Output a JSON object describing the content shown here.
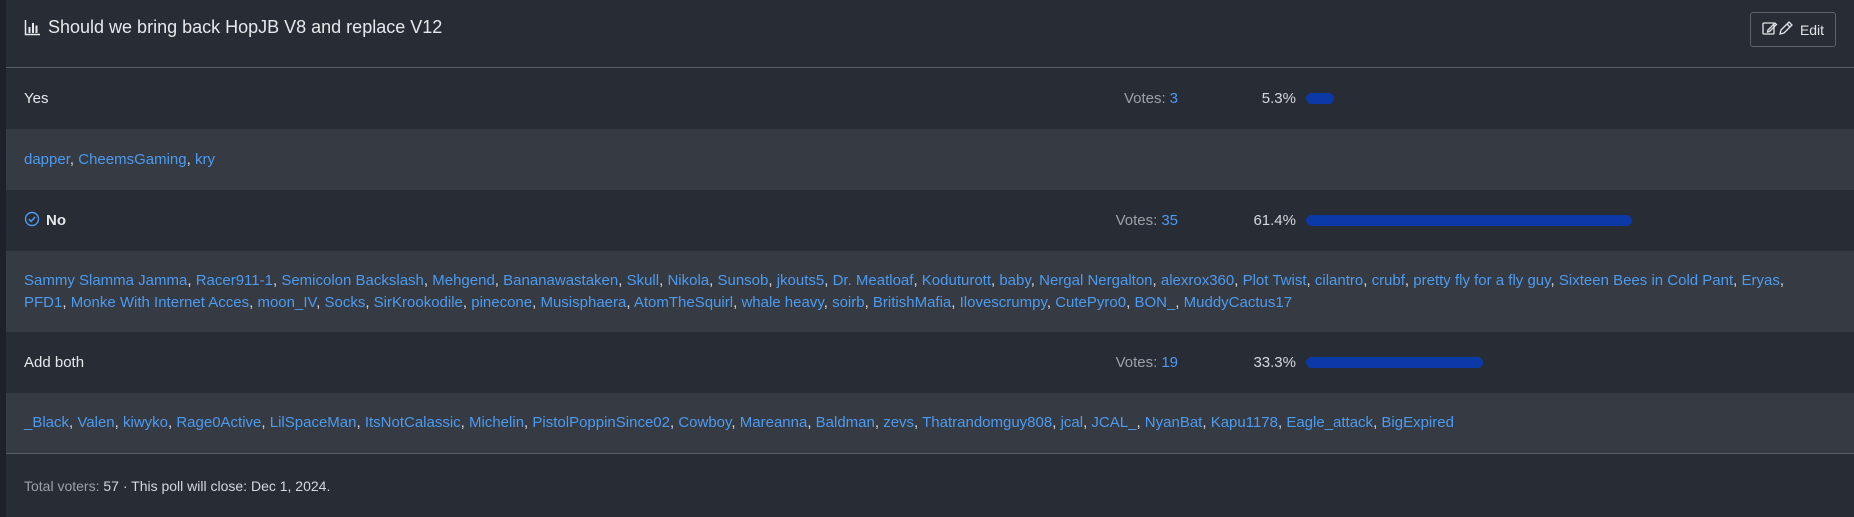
{
  "poll": {
    "title": "Should we bring back HopJB V8 and replace V12",
    "edit_label": "Edit",
    "options": [
      {
        "label": "Yes",
        "selected": false,
        "votes_label": "Votes:",
        "votes": "3",
        "percent": "5.3%",
        "fraction": 0.087,
        "voters": [
          "dapper",
          "CheemsGaming",
          "kry"
        ]
      },
      {
        "label": "No",
        "selected": true,
        "votes_label": "Votes:",
        "votes": "35",
        "percent": "61.4%",
        "fraction": 1.0,
        "voters": [
          "Sammy Slamma Jamma",
          "Racer911-1",
          "Semicolon Backslash",
          "Mehgend",
          "Bananawastaken",
          "Skull",
          "Nikola",
          "Sunsob",
          "jkouts5",
          "Dr. Meatloaf",
          "Koduturott",
          "baby",
          "Nergal Nergalton",
          "alexrox360",
          "Plot Twist",
          "cilantro",
          "crubf",
          "pretty fly for a fly guy",
          "Sixteen Bees in Cold Pant",
          "Eryas",
          "PFD1",
          "Monke With Internet Acces",
          "moon_IV",
          "Socks",
          "SirKrookodile",
          "pinecone",
          "Musisphaera",
          "AtomTheSquirl",
          "whale heavy",
          "soirb",
          "BritishMafia",
          "Ilovescrumpy",
          "CutePyro0",
          "BON_",
          "MuddyCactus17"
        ]
      },
      {
        "label": "Add both",
        "selected": false,
        "votes_label": "Votes:",
        "votes": "19",
        "percent": "33.3%",
        "fraction": 0.543,
        "voters": [
          "_Black",
          "Valen",
          "kiwyko",
          "Rage0Active",
          "LilSpaceMan",
          "ItsNotCalassic",
          "Michelin",
          "PistolPoppinSince02",
          "Cowboy",
          "Mareanna",
          "Baldman",
          "zevs",
          "Thatrandomguy808",
          "jcal",
          "JCAL_",
          "NyanBat",
          "Kapu1178",
          "Eagle_attack",
          "BigExpired"
        ]
      }
    ],
    "footer": {
      "total_label": "Total voters:",
      "total": "57",
      "close_text": "· This poll will close: Dec 1, 2024."
    },
    "colors": {
      "link": "#4c9bf0",
      "bar": "#0b3aa8",
      "row": "#282c34",
      "voter_row": "#363a42"
    },
    "icons": {
      "title": "bar-chart-icon",
      "edit": "edit-pencil-icon",
      "selected": "check-circle-icon"
    }
  }
}
